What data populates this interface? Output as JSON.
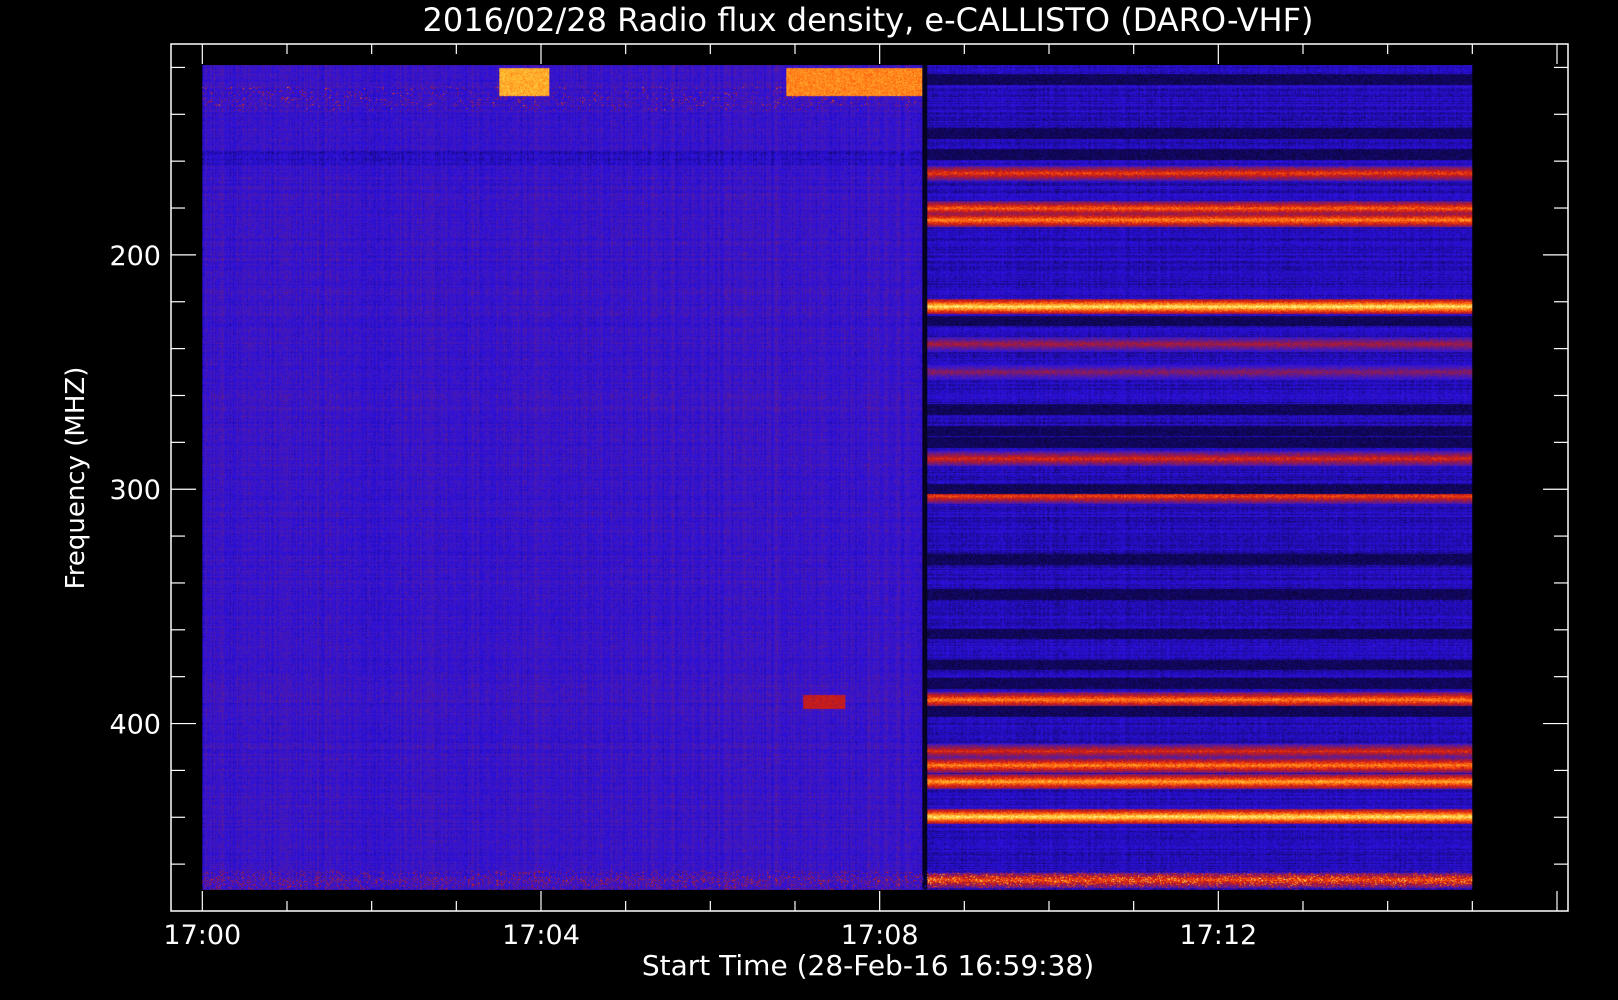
{
  "chart_data": {
    "type": "heatmap",
    "title": "2016/02/28  Radio flux density, e-CALLISTO (DARO-VHF)",
    "xlabel": "Start Time (28-Feb-16 16:59:38)",
    "ylabel": "Frequency (MHZ)",
    "x_ticks": [
      "17:00",
      "17:04",
      "17:08",
      "17:12"
    ],
    "y_ticks": [
      "200",
      "300",
      "400"
    ],
    "x_range_minutes": [
      -0.37,
      16.13
    ],
    "data_x_range_minutes": [
      0,
      15
    ],
    "y_range_mhz": [
      110,
      480
    ],
    "data_y_range_mhz": [
      119,
      471
    ],
    "y_inverted": true,
    "colormap": [
      "#000000",
      "#1a0a8c",
      "#2a10e0",
      "#4a1ab0",
      "#8a1a5a",
      "#d01a10",
      "#ff6010",
      "#ffc030",
      "#ffffa0"
    ],
    "background_level": 0.3,
    "burst_onset_minute": 8.5,
    "bands_after_onset_mhz": [
      {
        "f": 165,
        "level": 0.7
      },
      {
        "f": 180,
        "level": 0.75
      },
      {
        "f": 185,
        "level": 0.8
      },
      {
        "f": 222,
        "level": 0.95
      },
      {
        "f": 238,
        "level": 0.55
      },
      {
        "f": 250,
        "level": 0.5
      },
      {
        "f": 287,
        "level": 0.65
      },
      {
        "f": 303,
        "level": 0.7
      },
      {
        "f": 390,
        "level": 0.8
      },
      {
        "f": 412,
        "level": 0.65
      },
      {
        "f": 418,
        "level": 0.8
      },
      {
        "f": 425,
        "level": 0.85
      },
      {
        "f": 440,
        "level": 0.95
      },
      {
        "f": 467,
        "level": 0.7
      }
    ],
    "dark_bands_after_onset_mhz": [
      125,
      148,
      157,
      228,
      266,
      275,
      280,
      300,
      330,
      345,
      362,
      375,
      383,
      395
    ],
    "interference_patches": [
      {
        "t0": 3.5,
        "t1": 4.1,
        "f0": 120,
        "f1": 132,
        "level": 0.85
      },
      {
        "t0": 6.9,
        "t1": 8.5,
        "f0": 120,
        "f1": 132,
        "level": 0.8
      },
      {
        "t0": 7.1,
        "t1": 7.6,
        "f0": 388,
        "f1": 394,
        "level": 0.6
      }
    ]
  }
}
